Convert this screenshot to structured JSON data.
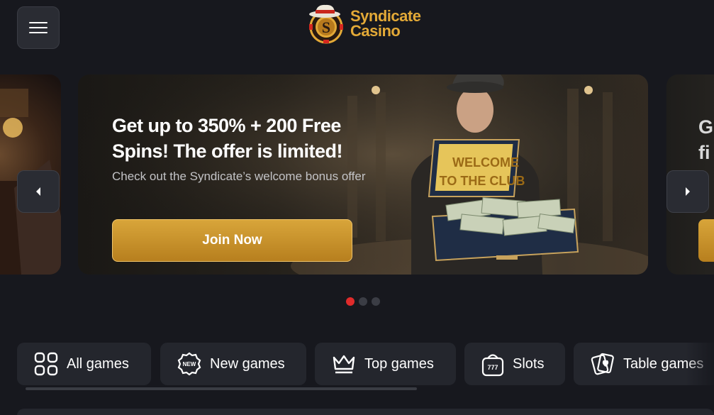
{
  "header": {
    "menu_icon": "hamburger-menu-icon",
    "logo": {
      "line1": "Syndicate",
      "line2": "Casino",
      "accent": "#e3a937"
    }
  },
  "carousel": {
    "active_slide": {
      "title": "Get up to 350% + 200 Free Spins! The offer is limited!",
      "subtitle": "Check out the Syndicate’s welcome bonus offer",
      "button": "Join Now",
      "image_text_line1": "WELCOME",
      "image_text_line2": "TO THE CLUB"
    },
    "next_slide_peek": {
      "title_line1": "G",
      "title_line2": "fi"
    },
    "prev_icon": "chevron-left-icon",
    "next_icon": "chevron-right-icon",
    "dots": {
      "count": 3,
      "active_index": 0,
      "active_color": "#e02b2b"
    }
  },
  "categories": [
    {
      "label": "All games",
      "icon": "grid-icon"
    },
    {
      "label": "New games",
      "icon": "new-badge-icon"
    },
    {
      "label": "Top games",
      "icon": "crown-icon"
    },
    {
      "label": "Slots",
      "icon": "slot-machine-icon"
    },
    {
      "label": "Table games",
      "icon": "cards-icon"
    }
  ]
}
